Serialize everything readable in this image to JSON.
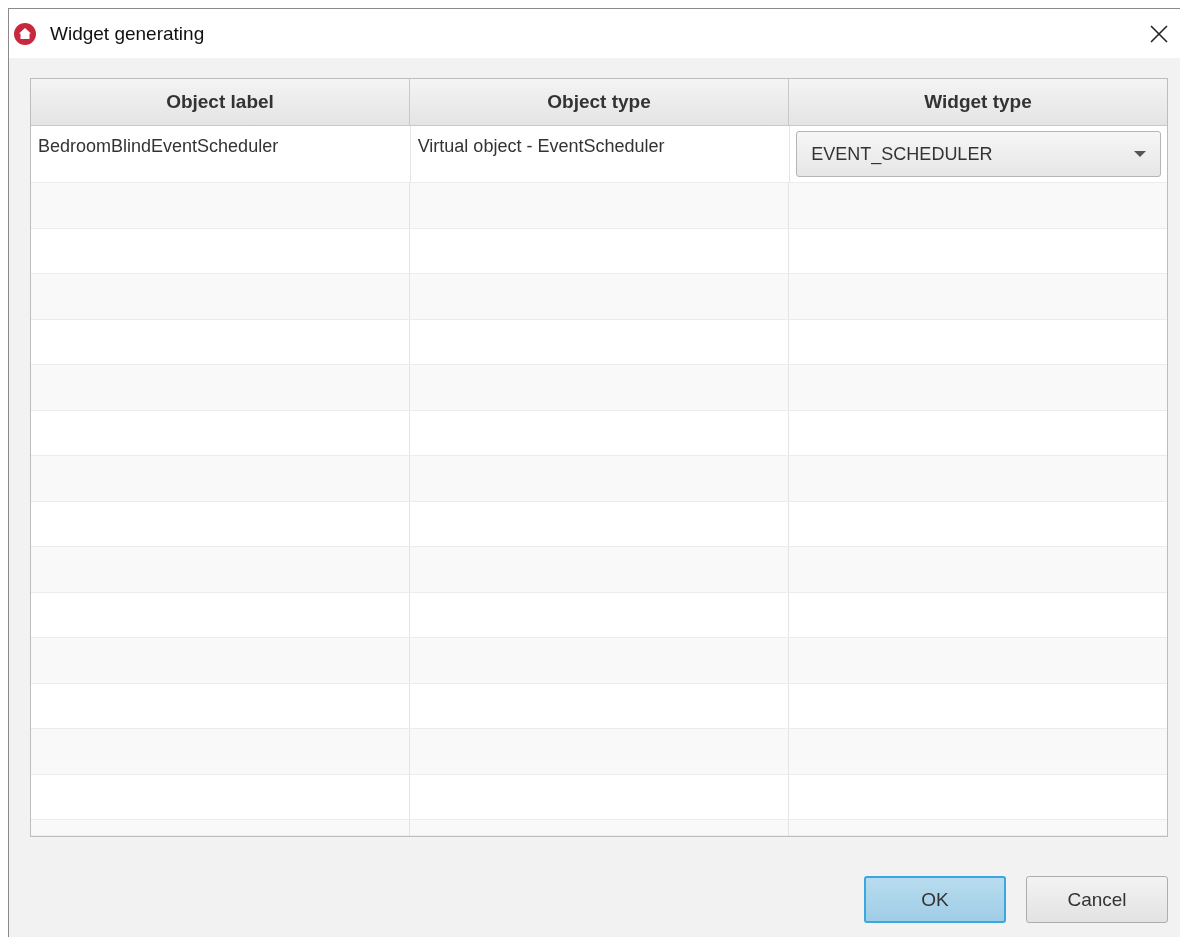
{
  "window": {
    "title": "Widget generating"
  },
  "table": {
    "columns": [
      "Object label",
      "Object type",
      "Widget type"
    ],
    "rows": [
      {
        "object_label": "BedroomBlindEventScheduler",
        "object_type": "Virtual object - EventScheduler",
        "widget_type": "EVENT_SCHEDULER"
      }
    ]
  },
  "buttons": [
    {
      "label": "OK",
      "default": true
    },
    {
      "label": "Cancel",
      "default": false
    }
  ]
}
